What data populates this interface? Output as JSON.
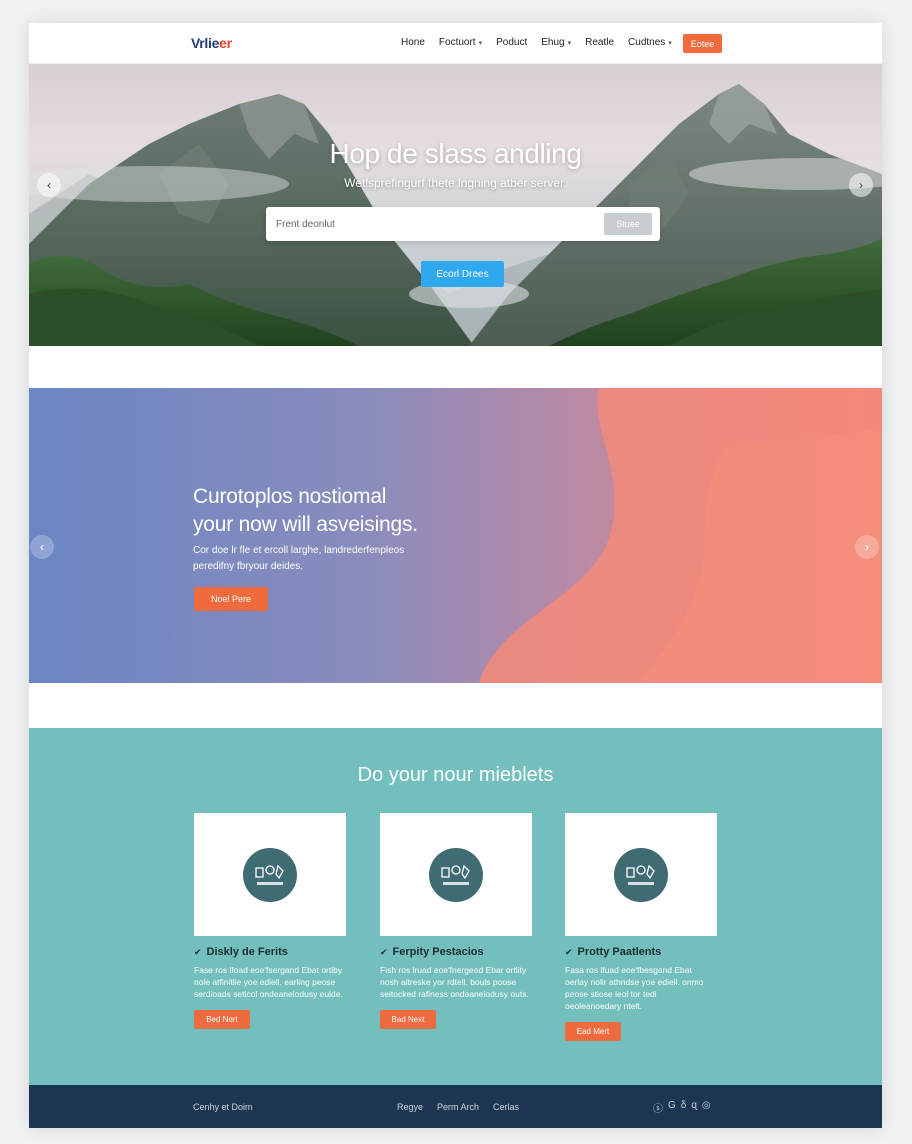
{
  "nav": {
    "logo_part1": "Vrlie",
    "logo_part2": "er",
    "items": [
      {
        "label": "Hone",
        "has_caret": false
      },
      {
        "label": "Foctuort",
        "has_caret": true
      },
      {
        "label": "Poduct",
        "has_caret": false
      },
      {
        "label": "Ehug",
        "has_caret": true
      },
      {
        "label": "Reatle",
        "has_caret": false
      },
      {
        "label": "Cudtnes",
        "has_caret": true
      }
    ],
    "cta_label": "Eotee"
  },
  "hero": {
    "title": "Hop de slass andling",
    "subtitle": "Wetlsprefingurf thete lngning atber server.",
    "search_placeholder": "Frent deonlut",
    "search_button": "Stuee",
    "cta_label": "Ecorl Drees",
    "prev_arrow": "‹",
    "next_arrow": "›"
  },
  "promo": {
    "title_line1": "Curotoplos nostiomal",
    "title_line2": "your now will asveisings.",
    "text_line1": "Cor doe lr fle et ercoll larghe, landrederfenpleos",
    "text_line2": "peredifny fbryour deides.",
    "cta_label": "Noel Pere",
    "prev_arrow": "‹",
    "next_arrow": "›"
  },
  "features": {
    "title": "Do your nour mieblets",
    "cards": [
      {
        "title": "Diskly de Ferits",
        "text": "Fase ros lfoad eoe'fsergand Ebat ortiby nole atfinitlie yoe ediell. earling peose serdioads seticol ondeaneiodusy eulde.",
        "cta": "Bed Nert"
      },
      {
        "title": "Ferpity Pestacios",
        "text": "Fish ros lruad eoe'fnergeed Ebar ortlity nosh aitreske yor rdtell. bouls poose seitocked rafiness ondeaneiodusy outs.",
        "cta": "Bad Next"
      },
      {
        "title": "Protty Paatlents",
        "text": "Fasa ros lfuad eoe'fbesgand Ebat oerlay nolir athndse yoe ediell. onmo peose stiose leol tor tedi oeoleanoedary ntelt.",
        "cta": "Ead Mert"
      }
    ]
  },
  "footer": {
    "copyright": "Cenhy et Doim",
    "links": [
      "Regye",
      "Perm Arch",
      "Cerlas"
    ],
    "social": [
      "ⓢ",
      "G",
      "δ",
      "ɋ",
      "◎"
    ]
  },
  "colors": {
    "accent_orange": "#ef6b3d",
    "hero_cta_blue": "#2ea8f1",
    "features_teal": "#72bfbd",
    "footer_navy": "#1c3550",
    "promo_gradient_start": "#6a86c4",
    "promo_gradient_end": "#f28b7a"
  }
}
